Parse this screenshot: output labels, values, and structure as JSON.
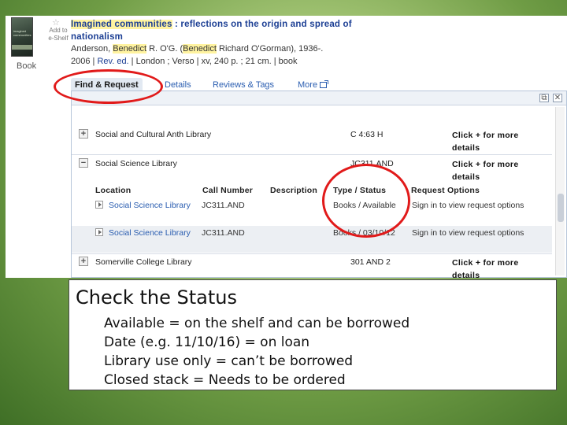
{
  "catalog": {
    "book_thumbnail": {
      "cover_text": "imagined communities",
      "format_label": "Book"
    },
    "shelf_widget": {
      "icon": "star-icon",
      "label": "Add to e-Shelf"
    },
    "record": {
      "title_parts": [
        "Imagined communities",
        " : reflections on the origin and spread of nationalism"
      ],
      "author_parts": [
        "Anderson, ",
        "Benedict",
        " R. O'G. (",
        "Benedict",
        " Richard O'Gorman), 1936-."
      ],
      "pub_parts": [
        "2006",
        " | ",
        "Rev. ed.",
        " | ",
        "London ; Verso",
        " | ",
        "xv, 240 p. ; 21 cm.",
        " | ",
        "book"
      ]
    },
    "tabs": [
      {
        "label": "Find & Request",
        "active": true
      },
      {
        "label": "Details"
      },
      {
        "label": "Reviews & Tags"
      },
      {
        "label": "More",
        "icon": "popout-icon"
      }
    ],
    "panel_controls": [
      "popout-icon",
      "close-icon"
    ],
    "libraries": [
      {
        "expander": "+",
        "name": "Social and Cultural Anth Library",
        "call_number": "C 4:63 H",
        "more": "Click + for more details"
      },
      {
        "expander": "−",
        "name": "Social Science Library",
        "call_number": "JC311.AND",
        "more": "Click + for more details"
      },
      {
        "expander": "+",
        "name": "Somerville College Library",
        "call_number": "301 AND 2",
        "more": "Click + for more details"
      }
    ],
    "holdings_headers": [
      "Location",
      "Call Number",
      "Description",
      "Type / Status",
      "Request Options"
    ],
    "holdings": [
      {
        "location": "Social Science Library",
        "call_number": "JC311.AND",
        "description": "",
        "status": "Books / Available",
        "request": "Sign in to view request options"
      },
      {
        "location": "Social Science Library",
        "call_number": "JC311.AND",
        "description": "",
        "status": "Books / 03/10/12",
        "request": "Sign in to view request options"
      }
    ]
  },
  "annotations": {
    "color": "#e11a1a",
    "rings_around": [
      "find-request-tab",
      "type-status-column"
    ]
  },
  "callout": {
    "title": "Check the Status",
    "lines": [
      "Available = on the shelf and can be borrowed",
      "Date (e.g. 11/10/16) = on loan",
      "Library use only = can’t be borrowed",
      "Closed stack = Needs to be ordered"
    ]
  }
}
